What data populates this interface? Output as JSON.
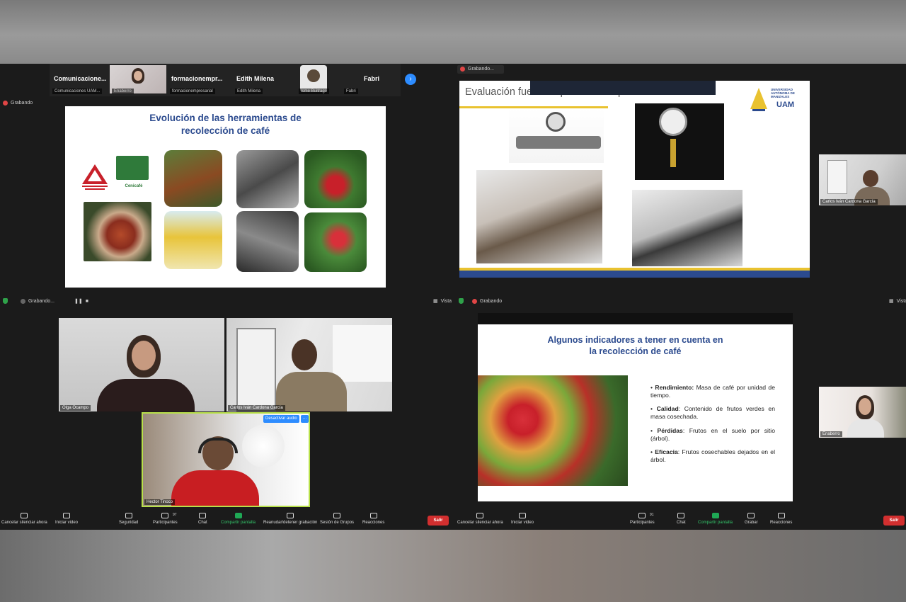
{
  "thumbnails": [
    {
      "name": "Comunicacione...",
      "tag": "Comunicaciones UAM..."
    },
    {
      "name": "",
      "tag": "Enaberro"
    },
    {
      "name": "formacionempr...",
      "tag": "formacionempresarial"
    },
    {
      "name": "Edith Milena",
      "tag": "Edith Milena"
    },
    {
      "name": "",
      "tag": "Isme Buitrago"
    },
    {
      "name": "Fabri",
      "tag": "Fabri"
    }
  ],
  "recording_label": "Grabando",
  "recording_label_dots": "Grabando...",
  "view_label": "Vista",
  "slide1": {
    "title_line1": "Evolución de las herramientas de",
    "title_line2": "recolección de café",
    "logo_label": "Cenicafé"
  },
  "slide2": {
    "title": "Evaluación fuerza impacto del dispositivo",
    "logo_text": "UNIVERSIDAD AUTÓNOMA DE MANIZALES",
    "logo_abbr": "UAM"
  },
  "side_video_1": {
    "tag": "Carlos Iván Cardona García"
  },
  "gallery": [
    {
      "tag": "Olga Ocampo"
    },
    {
      "tag": "Carlos Iván Cardona García"
    },
    {
      "tag": "Hector Tinoco"
    }
  ],
  "mute_button": "Desactivar audio",
  "more_button": "···",
  "slide3": {
    "title_line1": "Algunos indicadores a tener en cuenta en",
    "title_line2": "la recolección de café",
    "bullets": [
      {
        "term": "Rendimiento:",
        "text": " Masa de café por unidad de tiempo."
      },
      {
        "term": "Calidad",
        "text": ": Contenido de frutos verdes en masa cosechada."
      },
      {
        "term": "Pérdidas",
        "text": ": Frutos en el suelo por sitio (árbol)."
      },
      {
        "term": "Eficacia",
        "text": ": Frutos cosechables dejados en el árbol."
      }
    ]
  },
  "side_video_2": {
    "tag": "Enaberro"
  },
  "toolbar_left": [
    {
      "label": "Cancelar silenciar ahora",
      "count": ""
    },
    {
      "label": "Iniciar video",
      "count": ""
    },
    {
      "label": "Seguridad",
      "count": ""
    },
    {
      "label": "Participantes",
      "count": "97"
    },
    {
      "label": "Chat",
      "count": ""
    },
    {
      "label": "Compartir pantalla",
      "count": ""
    },
    {
      "label": "Reanudar/detener grabación",
      "count": ""
    },
    {
      "label": "Sesión de Grupos",
      "count": ""
    },
    {
      "label": "Reacciones",
      "count": ""
    }
  ],
  "toolbar_right": [
    {
      "label": "Cancelar silenciar ahora",
      "count": ""
    },
    {
      "label": "Iniciar video",
      "count": ""
    },
    {
      "label": "Participantes",
      "count": "91"
    },
    {
      "label": "Chat",
      "count": ""
    },
    {
      "label": "Compartir pantalla",
      "count": ""
    },
    {
      "label": "Grabar",
      "count": ""
    },
    {
      "label": "Reacciones",
      "count": ""
    }
  ],
  "end_button": "Salir",
  "colors": {
    "zoom_blue": "#2d8cff",
    "share_green": "#1fa855",
    "end_red": "#d22f2f",
    "slide_title": "#2b4a8e"
  }
}
